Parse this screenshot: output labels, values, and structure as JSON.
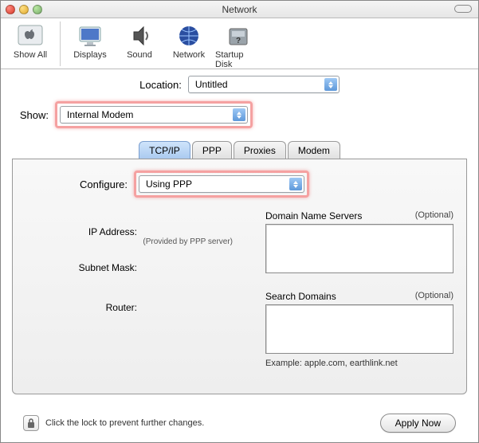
{
  "window": {
    "title": "Network"
  },
  "toolbar": {
    "show_all": "Show All",
    "displays": "Displays",
    "sound": "Sound",
    "network": "Network",
    "startup_disk": "Startup Disk"
  },
  "location": {
    "label": "Location:",
    "value": "Untitled"
  },
  "show": {
    "label": "Show:",
    "value": "Internal Modem"
  },
  "tabs": {
    "tcpip": "TCP/IP",
    "ppp": "PPP",
    "proxies": "Proxies",
    "modem": "Modem"
  },
  "configure": {
    "label": "Configure:",
    "value": "Using PPP"
  },
  "fields": {
    "ip_address_label": "IP Address:",
    "ip_provided": "(Provided by PPP server)",
    "subnet_label": "Subnet Mask:",
    "router_label": "Router:",
    "dns_label": "Domain Name Servers",
    "optional": "(Optional)",
    "search_label": "Search Domains",
    "example": "Example: apple.com, earthlink.net"
  },
  "footer": {
    "lock_text": "Click the lock to prevent further changes.",
    "apply": "Apply Now"
  }
}
